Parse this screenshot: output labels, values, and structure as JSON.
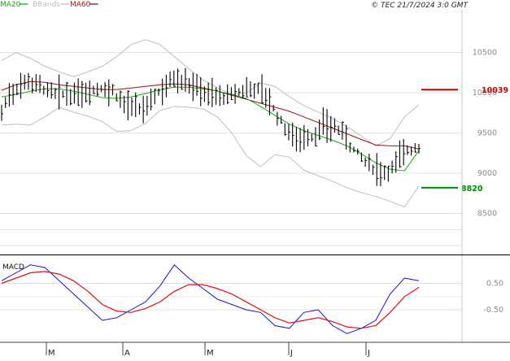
{
  "copyright": "© TEC 21/7/2024 3:0 GMT",
  "legend": [
    {
      "label": "MA20",
      "color": "#19a819"
    },
    {
      "label": "BBands",
      "color": "#bdbdbd"
    },
    {
      "label": "MA60",
      "color": "#9b1111"
    }
  ],
  "colors": {
    "price": "#000000",
    "ma20": "#19a819",
    "ma60": "#9b1111",
    "bbands": "#bdbdbd",
    "grid": "#e0e0e0",
    "frame": "#c8c8c8",
    "resistance": "#cc0000",
    "support": "#008800",
    "macd": "#1515cc",
    "signal": "#e01010"
  },
  "price_levels": {
    "resistance": {
      "value": 100.39,
      "label": "10039"
    },
    "support": {
      "value": 88.2,
      "label": "8820"
    }
  },
  "macd_label": "MACD",
  "chart_data": [
    {
      "type": "line",
      "title": "",
      "panel": "price",
      "note_bars": "daily high-low bars with close ticks",
      "x_tick_labels": [
        "M",
        "A",
        "M",
        "J",
        "J"
      ],
      "y_tick_labels": [
        "10500",
        "10000",
        "9500",
        "9000",
        "8500"
      ],
      "y_ticks": [
        105,
        100,
        95,
        90,
        85
      ],
      "ylim": [
        80,
        108.5
      ],
      "grid": true,
      "series": [
        {
          "name": "MA20",
          "values": [
            99.5,
            99.8,
            100.2,
            100.5,
            100.5,
            100.2,
            99.8,
            99.4,
            99.3,
            99.5,
            99.9,
            100.4,
            100.7,
            100.7,
            100.5,
            100.2,
            99.8,
            99.3,
            98.3,
            97.2,
            96.1,
            95.3,
            94.7,
            94.1,
            93.4,
            92.4,
            91.3,
            90.5,
            90.3,
            92.8
          ]
        },
        {
          "name": "MA60",
          "values": [
            100.3,
            101.0,
            101.4,
            101.3,
            101.0,
            100.8,
            100.6,
            100.4,
            100.4,
            100.6,
            100.8,
            101.0,
            101.1,
            101.0,
            100.6,
            100.2,
            99.7,
            99.2,
            98.7,
            98.2,
            97.7,
            97.0,
            96.3,
            95.6,
            94.9,
            94.2,
            93.5,
            93.4,
            93.4,
            93.0
          ]
        },
        {
          "name": "BBands upper",
          "values": [
            104.0,
            105.0,
            104.3,
            103.3,
            102.6,
            102.0,
            102.6,
            103.3,
            104.5,
            106.0,
            106.6,
            106.0,
            104.5,
            103.0,
            101.6,
            100.6,
            99.8,
            100.0,
            101.2,
            100.8,
            99.5,
            98.4,
            97.6,
            96.8,
            95.8,
            94.6,
            93.4,
            94.3,
            97.0,
            98.5
          ]
        },
        {
          "name": "BBands lower",
          "values": [
            96.0,
            96.1,
            96.0,
            97.0,
            98.2,
            97.6,
            97.1,
            96.4,
            95.2,
            95.3,
            96.2,
            97.8,
            98.3,
            98.2,
            98.0,
            97.0,
            95.0,
            92.2,
            90.8,
            92.3,
            92.0,
            90.4,
            89.7,
            89.0,
            88.2,
            87.6,
            87.1,
            86.5,
            85.8,
            88.4
          ]
        }
      ],
      "bars": {
        "start": 96.0,
        "end": 93.0
      }
    },
    {
      "type": "line",
      "title": "",
      "panel": "macd",
      "y_tick_labels": [
        "0.50",
        "-0.50"
      ],
      "y_ticks": [
        0.5,
        -0.5
      ],
      "ylim": [
        -1.7,
        1.5
      ],
      "series": [
        {
          "name": "MACD",
          "values": [
            0.6,
            0.9,
            1.2,
            1.1,
            0.6,
            0.1,
            -0.4,
            -0.9,
            -0.8,
            -0.5,
            -0.2,
            0.4,
            1.2,
            0.7,
            0.3,
            -0.1,
            -0.3,
            -0.5,
            -0.6,
            -1.1,
            -1.2,
            -0.6,
            -0.5,
            -1.1,
            -1.4,
            -1.2,
            -0.9,
            0.1,
            0.7,
            0.6
          ]
        },
        {
          "name": "Signal",
          "values": [
            0.5,
            0.7,
            0.9,
            0.95,
            0.85,
            0.6,
            0.2,
            -0.3,
            -0.55,
            -0.6,
            -0.45,
            -0.2,
            0.2,
            0.45,
            0.45,
            0.3,
            0.1,
            -0.2,
            -0.5,
            -0.8,
            -1.0,
            -0.9,
            -0.8,
            -0.95,
            -1.15,
            -1.2,
            -1.1,
            -0.6,
            0.0,
            0.35
          ]
        }
      ]
    }
  ]
}
